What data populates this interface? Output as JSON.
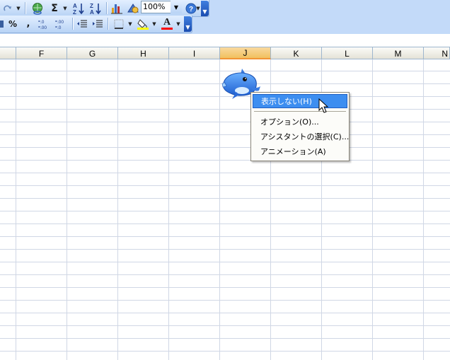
{
  "toolbar": {
    "zoom_value": "100%",
    "sigma_glyph": "Σ",
    "percent_glyph": "%",
    "comma_glyph": ",",
    "inc_decimal_glyph": "+.0\n.00",
    "dec_decimal_glyph": ".00\n→.0",
    "sort_asc_glyph": "A↓Z",
    "sort_desc_glyph": "Z↓A",
    "help_glyph": "?",
    "font_color_glyph": "A",
    "dropdown_glyph": "▼"
  },
  "grid": {
    "columns": [
      "F",
      "G",
      "H",
      "I",
      "J",
      "K",
      "L",
      "M",
      "N"
    ],
    "selected_column": "J"
  },
  "context_menu": {
    "items": [
      {
        "label": "表示しない(H)",
        "highlighted": true
      },
      {
        "label": "オプション(O)..."
      },
      {
        "label": "アシスタントの選択(C)..."
      },
      {
        "label": "アニメーション(A)"
      }
    ]
  },
  "colors": {
    "toolbar_bg": "#c3daf9",
    "selected_column": "#f1c15f",
    "menu_highlight": "#3d8ef0",
    "font_color_bar": "#ff0000"
  }
}
